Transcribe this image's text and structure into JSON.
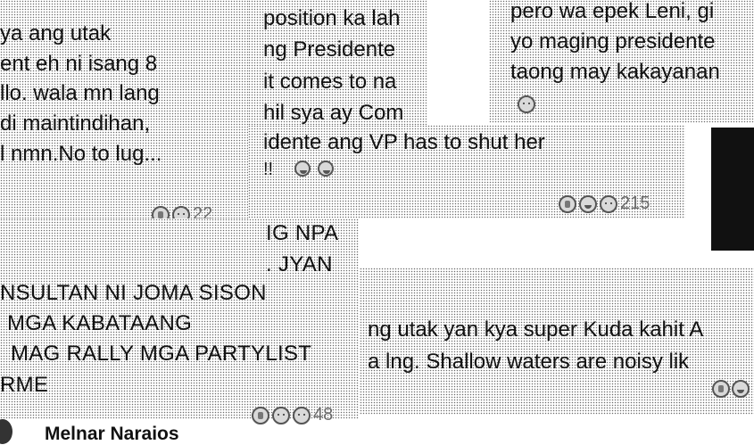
{
  "comments": {
    "c1": {
      "lines": [
        "ya ang utak",
        "ent eh ni isang 8",
        "llo. wala mn lang",
        "di maintindihan,",
        "l nmn.No to lug..."
      ],
      "reaction_count": "22",
      "reaction_icons": [
        "like-reaction-icon",
        "sad-reaction-icon"
      ]
    },
    "c2": {
      "lines": [
        "position ka lah",
        "ng Presidente",
        "it comes to na",
        "hil sya ay Com",
        "idente ang VP has to shut her",
        "!!"
      ],
      "trailing_icons": [
        "laughing-emoji-icon",
        "laughing-emoji-icon"
      ]
    },
    "c3": {
      "lines": [
        "pero wa epek Leni, gi",
        "yo maging presidente",
        "taong may kakayanan"
      ],
      "reaction_count": "215",
      "reaction_icons": [
        "like-reaction-icon",
        "haha-reaction-icon",
        "sad-reaction-icon"
      ]
    },
    "c4": {
      "lines": [
        "IG NPA",
        ". JYAN",
        "NSULTAN NI JOMA SISON",
        "MGA KABATAANG",
        "MAG RALLY MGA PARTYLIST",
        "RME"
      ],
      "reaction_count": "48",
      "reaction_icons": [
        "like-reaction-icon",
        "sad-reaction-icon",
        "sad-reaction-icon"
      ]
    },
    "c5": {
      "lines": [
        "ng utak yan kya super Kuda kahit A",
        "a lng. Shallow waters are noisy lik"
      ]
    },
    "c6": {
      "author": "Melnar Naraios"
    }
  },
  "colors": {
    "text": "#111111",
    "muted": "#6b6b6b",
    "dark_block": "#111111"
  }
}
